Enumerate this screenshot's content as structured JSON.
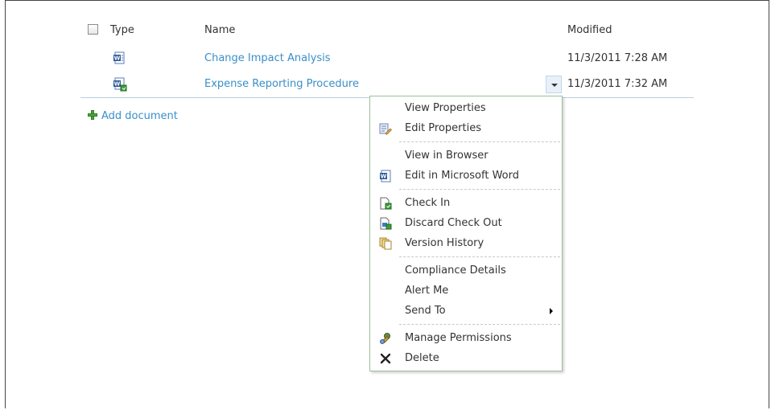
{
  "columns": {
    "type": "Type",
    "name": "Name",
    "modified": "Modified"
  },
  "rows": [
    {
      "name": "Change Impact Analysis",
      "modified": "11/3/2011 7:28 AM",
      "icon": "word-doc-icon"
    },
    {
      "name": "Expense Reporting Procedure",
      "modified": "11/3/2011 7:32 AM",
      "icon": "word-doc-checked-out-icon"
    }
  ],
  "add_document": "Add document",
  "menu": {
    "items": [
      {
        "label": "View Properties",
        "icon": ""
      },
      {
        "label": "Edit Properties",
        "icon": "edit-properties-icon"
      },
      {
        "label": "View in Browser",
        "icon": ""
      },
      {
        "label": "Edit in Microsoft Word",
        "icon": "word-icon"
      },
      {
        "label": "Check In",
        "icon": "check-in-icon"
      },
      {
        "label": "Discard Check Out",
        "icon": "discard-checkout-icon"
      },
      {
        "label": "Version History",
        "icon": "version-history-icon"
      },
      {
        "label": "Compliance Details",
        "icon": ""
      },
      {
        "label": "Alert Me",
        "icon": ""
      },
      {
        "label": "Send To",
        "icon": "submenu-arrow"
      },
      {
        "label": "Manage Permissions",
        "icon": "permissions-icon"
      },
      {
        "label": "Delete",
        "icon": "delete-icon"
      }
    ]
  },
  "colors": {
    "link": "#3a8fc8",
    "text": "#333333",
    "menu_border": "#9dbf9c"
  }
}
